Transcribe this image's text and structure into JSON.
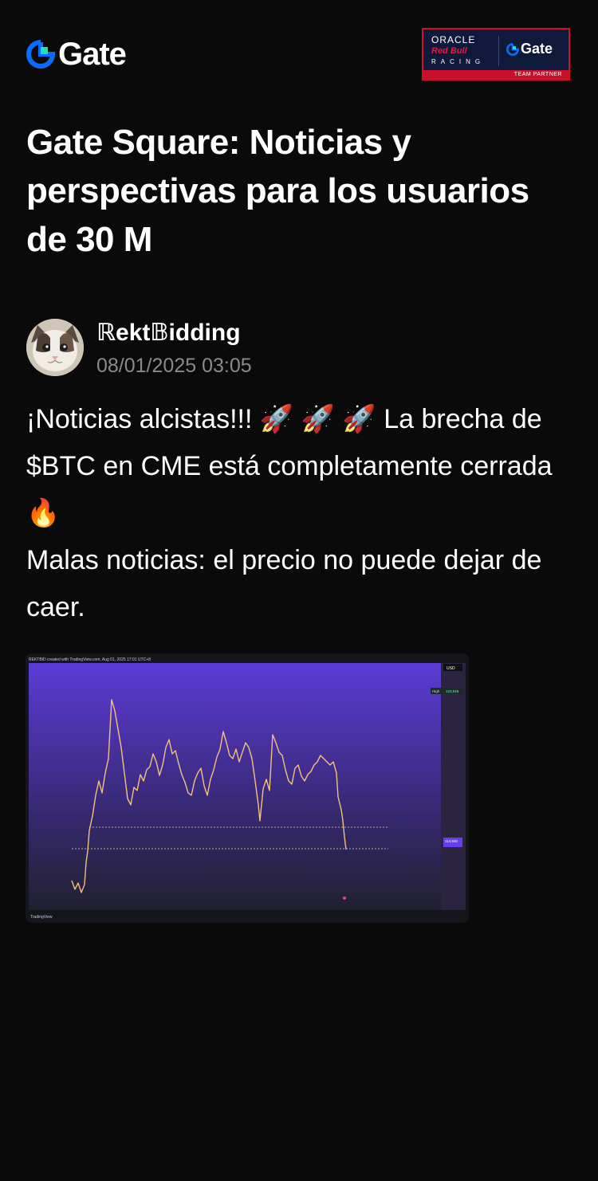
{
  "header": {
    "logo_text": "Gate",
    "partner": {
      "line1": "ORACLE",
      "line2": "Red Bull",
      "line3": "RACING",
      "brand": "Gate",
      "tag": "TEAM PARTNER"
    }
  },
  "title": "Gate Square: Noticias y perspectivas para los usuarios de 30 M",
  "author": {
    "name": "ℝekt𝔹idding",
    "date": "08/01/2025 03:05"
  },
  "post": {
    "line1": "¡Noticias alcistas!!! 🚀 🚀 🚀 La brecha de $BTC en CME está completamente cerrada 🔥",
    "line2": "Malas noticias: el precio no puede dejar de caer."
  },
  "chart": {
    "header_text": "REKTBID created with TradingView.com, Aug 01, 2025 17:01 UTC+8",
    "currency": "USD",
    "high_label": "High",
    "high_value": "123,015",
    "current_value": "114,845",
    "footer_logo": "TradingView"
  },
  "colors": {
    "background": "#0a0a0a",
    "accent_blue": "#0b6dfb",
    "accent_green": "#17e5b8",
    "date_gray": "#8a8a8a"
  }
}
